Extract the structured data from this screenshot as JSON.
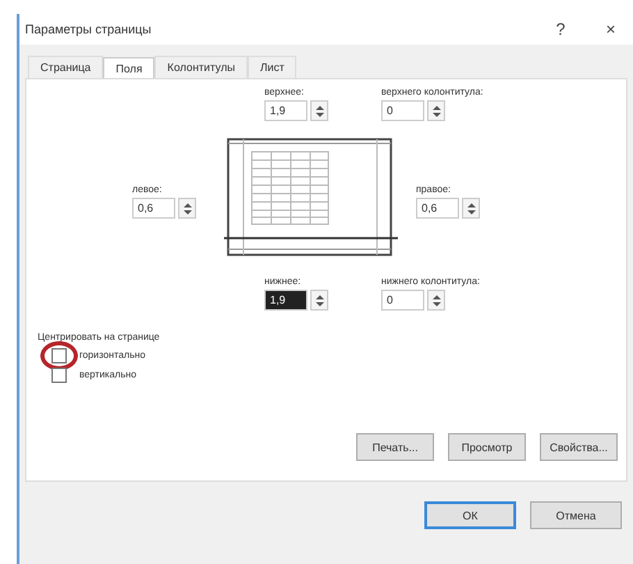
{
  "window": {
    "title": "Параметры страницы",
    "help": "?",
    "close": "×"
  },
  "tabs": [
    {
      "label": "Страница",
      "selected": false
    },
    {
      "label": "Поля",
      "selected": true
    },
    {
      "label": "Колонтитулы",
      "selected": false
    },
    {
      "label": "Лист",
      "selected": false
    }
  ],
  "fields": [
    {
      "label": "верхнее:",
      "value": "1,9",
      "selected": false
    },
    {
      "label": "верхнего колонтитула:",
      "value": "0",
      "selected": false
    },
    {
      "label": "левое:",
      "value": "0,6",
      "selected": false
    },
    {
      "label": "правое:",
      "value": "0,6",
      "selected": false
    },
    {
      "label": "нижнее:",
      "value": "1,9",
      "selected": true
    },
    {
      "label": "нижнего колонтитула:",
      "value": "0",
      "selected": false
    }
  ],
  "center": {
    "title": "Центрировать на странице",
    "options": [
      {
        "label": "горизонтально",
        "checked": false,
        "circled": true
      },
      {
        "label": "вертикально",
        "checked": false,
        "circled": false
      }
    ]
  },
  "buttons": [
    "Печать...",
    "Просмотр",
    "Свойства..."
  ],
  "footer_buttons": [
    {
      "label": "ОК",
      "default": true
    },
    {
      "label": "Отмена",
      "default": false
    }
  ]
}
